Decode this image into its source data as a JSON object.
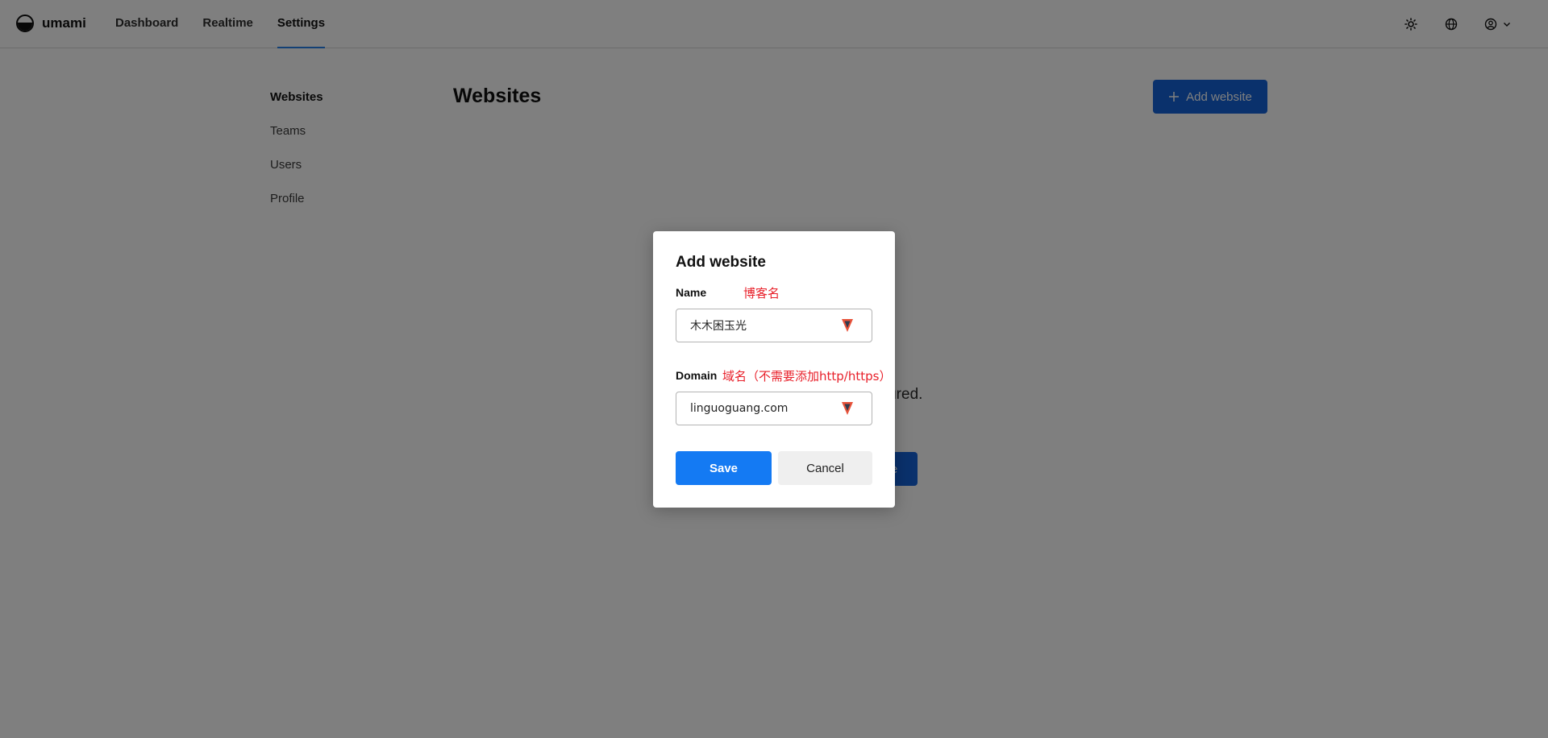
{
  "app": {
    "name": "umami"
  },
  "nav": {
    "items": [
      {
        "label": "Dashboard"
      },
      {
        "label": "Realtime"
      },
      {
        "label": "Settings"
      }
    ],
    "active": "Settings"
  },
  "top_icons": [
    "sun-icon",
    "globe-icon",
    "user-icon",
    "chevron-down-icon"
  ],
  "settings": {
    "side_items": [
      {
        "label": "Websites"
      },
      {
        "label": "Teams"
      },
      {
        "label": "Users"
      },
      {
        "label": "Profile"
      }
    ],
    "page_title": "Websites",
    "add_button_label": "Add website",
    "add_button_icon": "plus-icon",
    "empty_text": "ites configured.",
    "empty_button_label": "e"
  },
  "modal": {
    "title": "Add website",
    "name_label": "Name",
    "name_annotation": "博客名",
    "name_value": "木木困玉光",
    "domain_label": "Domain",
    "domain_annotation": "域名（不需要添加http/https）",
    "domain_value": "linguoguang.com",
    "save_label": "Save",
    "cancel_label": "Cancel"
  },
  "colors": {
    "accent": "#147af3",
    "primary_button": "#1463d8",
    "annotation": "#e8202a",
    "overlay": "rgba(0,0,0,0.5)"
  }
}
